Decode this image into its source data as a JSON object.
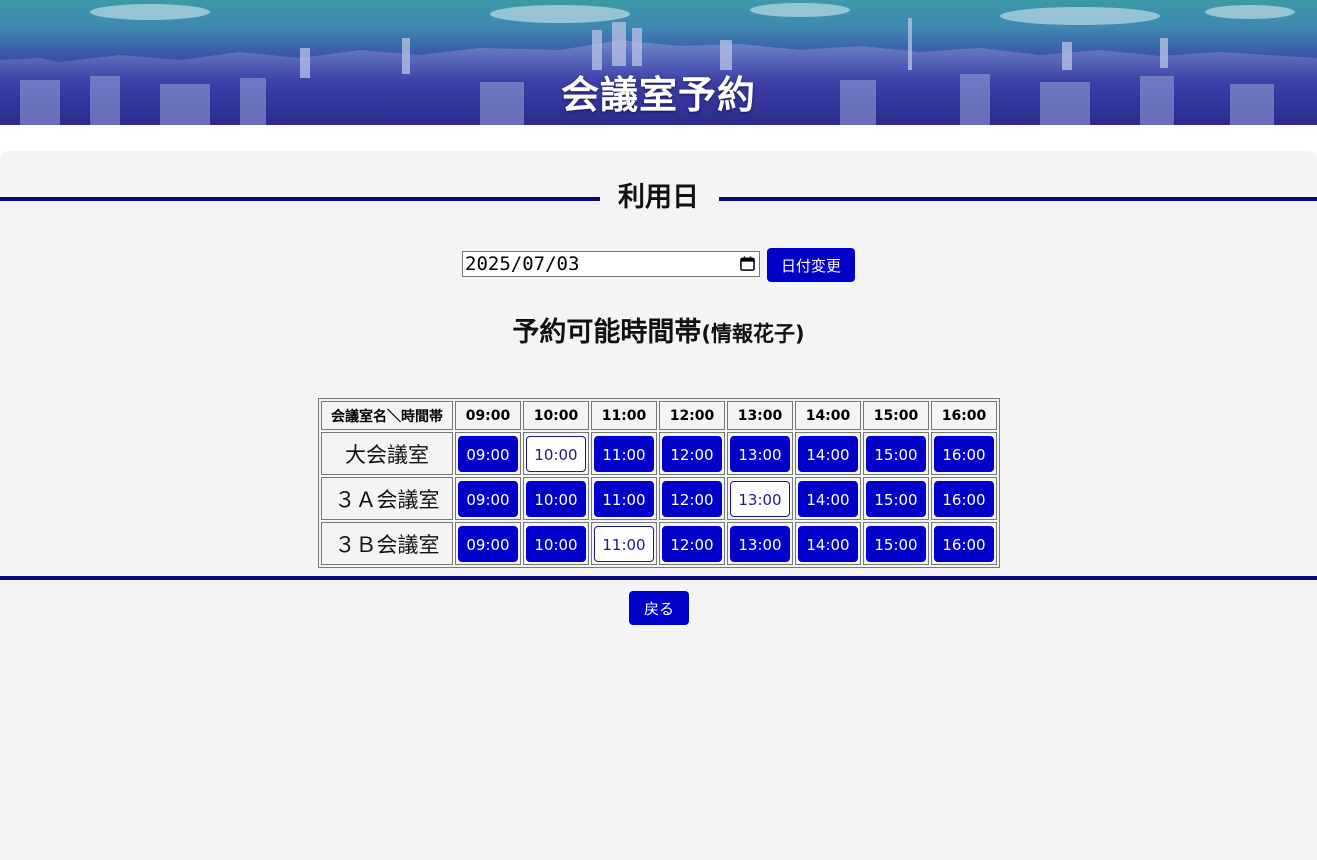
{
  "header": {
    "title": "会議室予約"
  },
  "date_section": {
    "title": "利用日",
    "date_value": "2025/07/03",
    "change_button": "日付変更"
  },
  "availability": {
    "title": "予約可能時間帯",
    "user": "(情報花子)"
  },
  "table": {
    "corner": "会議室名＼時間帯",
    "times": [
      "09:00",
      "10:00",
      "11:00",
      "12:00",
      "13:00",
      "14:00",
      "15:00",
      "16:00"
    ],
    "rooms": [
      {
        "name": "大会議室",
        "slots": [
          {
            "label": "09:00",
            "available": true
          },
          {
            "label": "10:00",
            "available": false
          },
          {
            "label": "11:00",
            "available": true
          },
          {
            "label": "12:00",
            "available": true
          },
          {
            "label": "13:00",
            "available": true
          },
          {
            "label": "14:00",
            "available": true
          },
          {
            "label": "15:00",
            "available": true
          },
          {
            "label": "16:00",
            "available": true
          }
        ]
      },
      {
        "name": "３Ａ会議室",
        "slots": [
          {
            "label": "09:00",
            "available": true
          },
          {
            "label": "10:00",
            "available": true
          },
          {
            "label": "11:00",
            "available": true
          },
          {
            "label": "12:00",
            "available": true
          },
          {
            "label": "13:00",
            "available": false
          },
          {
            "label": "14:00",
            "available": true
          },
          {
            "label": "15:00",
            "available": true
          },
          {
            "label": "16:00",
            "available": true
          }
        ]
      },
      {
        "name": "３Ｂ会議室",
        "slots": [
          {
            "label": "09:00",
            "available": true
          },
          {
            "label": "10:00",
            "available": true
          },
          {
            "label": "11:00",
            "available": false
          },
          {
            "label": "12:00",
            "available": true
          },
          {
            "label": "13:00",
            "available": true
          },
          {
            "label": "14:00",
            "available": true
          },
          {
            "label": "15:00",
            "available": true
          },
          {
            "label": "16:00",
            "available": true
          }
        ]
      }
    ]
  },
  "footer": {
    "back_button": "戻る"
  },
  "colors": {
    "accent": "#0000c8",
    "divider": "#0a0a7a",
    "booked_text": "#1a1a8c",
    "panel_bg": "#f4f4f4"
  }
}
